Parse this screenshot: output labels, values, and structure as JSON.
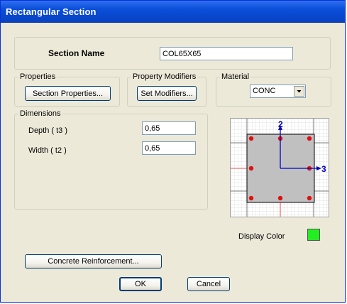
{
  "window": {
    "title": "Rectangular Section"
  },
  "section_name": {
    "label": "Section Name",
    "value": "COL65X65"
  },
  "properties": {
    "legend": "Properties",
    "button_label": "Section Properties..."
  },
  "property_modifiers": {
    "legend": "Property Modifiers",
    "button_label": "Set Modifiers..."
  },
  "material": {
    "legend": "Material",
    "selected": "CONC"
  },
  "dimensions": {
    "legend": "Dimensions",
    "depth_label": "Depth  ( t3 )",
    "depth_value": "0,65",
    "width_label": "Width  ( t2 )",
    "width_value": "0,65"
  },
  "preview": {
    "axis_vertical": "2",
    "axis_horizontal": "3",
    "rebar_count": 8
  },
  "display_color": {
    "label": "Display Color",
    "color": "#22ee22"
  },
  "buttons": {
    "reinforcement": "Concrete Reinforcement...",
    "ok": "OK",
    "cancel": "Cancel"
  },
  "colors": {
    "titlebar": "#0a4ed9",
    "dialog_bg": "#ece9d8",
    "section_fill": "#c0c0c0",
    "rebar": "#e01010",
    "axis": "#0000c0"
  }
}
